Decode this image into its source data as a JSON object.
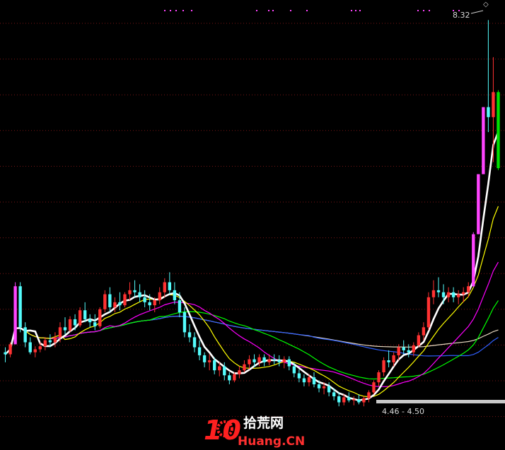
{
  "chart_data": {
    "type": "candlestick",
    "title": "",
    "xlabel": "",
    "ylabel": "",
    "ylim": [
      4.2,
      8.45
    ],
    "grid": true,
    "colors": {
      "up": "#ff3232",
      "down": "#54fcfc",
      "limit_up": "#ff44ff",
      "limit_down": "#00e000",
      "ma5": "#ffffff",
      "ma10": "#ffff00",
      "ma20": "#ff00ff",
      "ma30": "#00ff00",
      "ma60": "#3060ff",
      "ma120": "#e8d8c0"
    },
    "annotations": {
      "high_label": "8.32",
      "low_label": "4.46 - 4.50",
      "high_value": 8.32,
      "low_value": 4.46,
      "volume_marker": "◇"
    },
    "watermark": {
      "number": "10",
      "chinese": "拾荒网",
      "domain": "Huang.CN"
    },
    "candles": [
      [
        5.0,
        5.05,
        4.9,
        4.98
      ],
      [
        4.98,
        5.1,
        4.95,
        5.08
      ],
      [
        5.08,
        5.7,
        5.08,
        5.66
      ],
      [
        5.66,
        5.7,
        5.2,
        5.25
      ],
      [
        5.25,
        5.3,
        5.05,
        5.1
      ],
      [
        5.1,
        5.15,
        4.98,
        5.0
      ],
      [
        5.0,
        5.06,
        4.95,
        5.03
      ],
      [
        5.03,
        5.1,
        5.0,
        5.06
      ],
      [
        5.06,
        5.15,
        5.02,
        5.12
      ],
      [
        5.12,
        5.18,
        5.05,
        5.1
      ],
      [
        5.1,
        5.2,
        5.05,
        5.15
      ],
      [
        5.15,
        5.3,
        5.1,
        5.25
      ],
      [
        5.25,
        5.35,
        5.18,
        5.22
      ],
      [
        5.22,
        5.36,
        5.2,
        5.33
      ],
      [
        5.33,
        5.38,
        5.22,
        5.27
      ],
      [
        5.27,
        5.45,
        5.25,
        5.42
      ],
      [
        5.42,
        5.5,
        5.3,
        5.33
      ],
      [
        5.33,
        5.38,
        5.25,
        5.3
      ],
      [
        5.3,
        5.38,
        5.22,
        5.26
      ],
      [
        5.26,
        5.45,
        5.24,
        5.43
      ],
      [
        5.43,
        5.62,
        5.4,
        5.58
      ],
      [
        5.58,
        5.65,
        5.4,
        5.45
      ],
      [
        5.45,
        5.55,
        5.4,
        5.5
      ],
      [
        5.5,
        5.6,
        5.42,
        5.47
      ],
      [
        5.47,
        5.6,
        5.45,
        5.58
      ],
      [
        5.58,
        5.7,
        5.52,
        5.62
      ],
      [
        5.62,
        5.72,
        5.55,
        5.6
      ],
      [
        5.6,
        5.68,
        5.5,
        5.55
      ],
      [
        5.55,
        5.62,
        5.45,
        5.5
      ],
      [
        5.5,
        5.58,
        5.42,
        5.47
      ],
      [
        5.47,
        5.55,
        5.4,
        5.52
      ],
      [
        5.52,
        5.65,
        5.48,
        5.6
      ],
      [
        5.6,
        5.74,
        5.55,
        5.7
      ],
      [
        5.7,
        5.8,
        5.58,
        5.62
      ],
      [
        5.62,
        5.7,
        5.48,
        5.52
      ],
      [
        5.52,
        5.6,
        5.35,
        5.4
      ],
      [
        5.4,
        5.45,
        5.15,
        5.2
      ],
      [
        5.2,
        5.28,
        5.1,
        5.15
      ],
      [
        5.15,
        5.2,
        5.0,
        5.05
      ],
      [
        5.05,
        5.12,
        4.92,
        4.97
      ],
      [
        4.97,
        5.0,
        4.85,
        4.9
      ],
      [
        4.9,
        4.98,
        4.82,
        4.92
      ],
      [
        4.92,
        4.95,
        4.78,
        4.82
      ],
      [
        4.82,
        4.9,
        4.76,
        4.86
      ],
      [
        4.86,
        4.9,
        4.72,
        4.77
      ],
      [
        4.77,
        4.8,
        4.68,
        4.72
      ],
      [
        4.72,
        4.8,
        4.7,
        4.78
      ],
      [
        4.78,
        4.86,
        4.74,
        4.82
      ],
      [
        4.82,
        4.92,
        4.8,
        4.88
      ],
      [
        4.88,
        4.97,
        4.83,
        4.93
      ],
      [
        4.93,
        4.98,
        4.85,
        4.9
      ],
      [
        4.9,
        4.98,
        4.86,
        4.95
      ],
      [
        4.95,
        4.98,
        4.86,
        4.9
      ],
      [
        4.9,
        4.98,
        4.87,
        4.93
      ],
      [
        4.93,
        4.98,
        4.88,
        4.92
      ],
      [
        4.92,
        4.97,
        4.86,
        4.9
      ],
      [
        4.9,
        4.96,
        4.84,
        4.93
      ],
      [
        4.93,
        4.96,
        4.82,
        4.86
      ],
      [
        4.86,
        4.9,
        4.75,
        4.79
      ],
      [
        4.79,
        4.83,
        4.7,
        4.74
      ],
      [
        4.74,
        4.78,
        4.66,
        4.7
      ],
      [
        4.7,
        4.78,
        4.66,
        4.75
      ],
      [
        4.75,
        4.8,
        4.65,
        4.68
      ],
      [
        4.68,
        4.72,
        4.6,
        4.64
      ],
      [
        4.64,
        4.7,
        4.58,
        4.66
      ],
      [
        4.66,
        4.7,
        4.56,
        4.6
      ],
      [
        4.6,
        4.64,
        4.52,
        4.56
      ],
      [
        4.56,
        4.6,
        4.46,
        4.5
      ],
      [
        4.5,
        4.58,
        4.47,
        4.55
      ],
      [
        4.55,
        4.6,
        4.5,
        4.52
      ],
      [
        4.52,
        4.56,
        4.47,
        4.53
      ],
      [
        4.53,
        4.58,
        4.48,
        4.5
      ],
      [
        4.5,
        4.56,
        4.46,
        4.54
      ],
      [
        4.54,
        4.62,
        4.5,
        4.6
      ],
      [
        4.6,
        4.72,
        4.58,
        4.7
      ],
      [
        4.7,
        4.82,
        4.66,
        4.8
      ],
      [
        4.8,
        4.95,
        4.76,
        4.92
      ],
      [
        4.92,
        5.02,
        4.85,
        4.9
      ],
      [
        4.9,
        5.0,
        4.86,
        4.97
      ],
      [
        4.97,
        5.08,
        4.92,
        5.05
      ],
      [
        5.05,
        5.12,
        4.98,
        5.02
      ],
      [
        5.02,
        5.08,
        4.95,
        5.0
      ],
      [
        5.0,
        5.1,
        4.96,
        5.07
      ],
      [
        5.07,
        5.2,
        5.05,
        5.17
      ],
      [
        5.17,
        5.3,
        5.12,
        5.25
      ],
      [
        5.25,
        5.6,
        5.22,
        5.55
      ],
      [
        5.55,
        5.72,
        5.48,
        5.62
      ],
      [
        5.62,
        5.75,
        5.55,
        5.6
      ],
      [
        5.6,
        5.68,
        5.48,
        5.55
      ],
      [
        5.55,
        5.65,
        5.5,
        5.6
      ],
      [
        5.6,
        5.65,
        5.5,
        5.55
      ],
      [
        5.55,
        5.62,
        5.48,
        5.58
      ],
      [
        5.58,
        5.65,
        5.5,
        5.6
      ],
      [
        5.6,
        5.7,
        5.55,
        5.66
      ],
      [
        5.66,
        6.2,
        5.65,
        6.18
      ],
      [
        6.18,
        6.78,
        6.18,
        6.78
      ],
      [
        6.78,
        7.45,
        6.78,
        7.45
      ],
      [
        7.45,
        8.32,
        7.2,
        7.35
      ],
      [
        7.35,
        7.95,
        6.9,
        7.6
      ],
      [
        7.6,
        7.62,
        6.82,
        6.84
      ]
    ]
  }
}
